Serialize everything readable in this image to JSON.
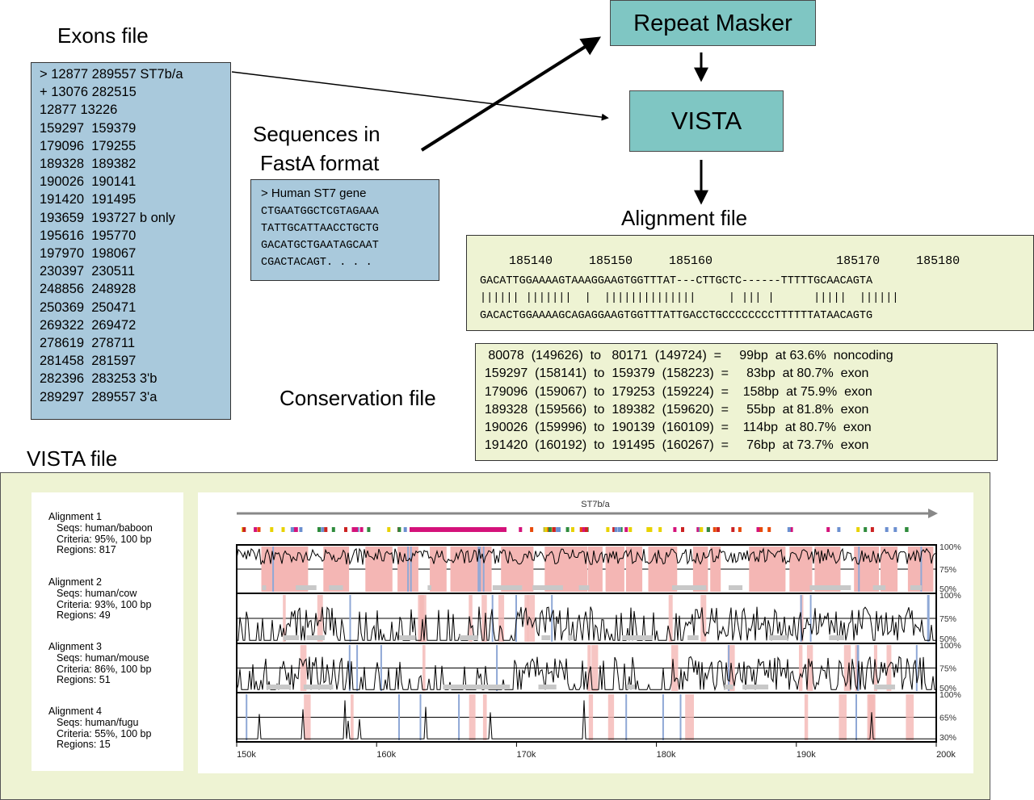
{
  "labels": {
    "exons_title": "Exons file",
    "sequences_title_1": "Sequences in",
    "sequences_title_2": "FastA format",
    "repeat_masker": "Repeat Masker",
    "vista": "VISTA",
    "alignment_title": "Alignment file",
    "conservation_title": "Conservation file",
    "vista_file_title": "VISTA file"
  },
  "exons_file": [
    "> 12877 289557 ST7b/a",
    "+ 13076 282515",
    "12877 13226",
    "159297  159379",
    "179096  179255",
    "189328  189382",
    "190026  190141",
    "191420  191495",
    "193659  193727 b only",
    "195616  195770",
    "197970  198067",
    "230397  230511",
    "248856  248928",
    "250369  250471",
    "269322  269472",
    "278619  278711",
    "281458  281597",
    "282396  283253 3'b",
    "289297  289557 3'a"
  ],
  "fasta": {
    "header": "> Human ST7 gene",
    "lines": [
      "CTGAATGGCTCGTAGAAA",
      "TATTGCATTAACCTGCTG",
      "GACATGCTGAATAGCAAT",
      "CGACTACAGT. . . ."
    ]
  },
  "alignment": {
    "positions": "    185140     185150     185160                 185170     185180",
    "seq1": "GACATTGGAAAAGTAAAGGAAGTGGTTTAT---CTTGCTC------TTTTTGCAACAGTA",
    "match": "|||||| |||||||  |  ||||||||||||||     | ||| |      |||||  ||||||",
    "seq2": "GACACTGGAAAAGCAGAGGAAGTGGTTTATTGACCTGCCCCCCCCTTTTTTATAACAGTG"
  },
  "conservation": [
    "   80078  (149626)  to   80171  (149724)  =     99bp  at 63.6%  noncoding",
    "  159297  (158141)  to  159379  (158223)  =     83bp  at 80.7%  exon",
    "  179096  (159067)  to  179253  (159224)  =    158bp  at 75.9%  exon",
    "  189328  (159566)  to  189382  (159620)  =     55bp  at 81.8%  exon",
    "  190026  (159996)  to  190139  (160109)  =    114bp  at 80.7%  exon",
    "  191420  (160192)  to  191495  (160267)  =     76bp  at 73.7%  exon"
  ],
  "vista_plot": {
    "gene_label": "ST7b/a",
    "alignments": [
      {
        "title": "Alignment 1",
        "seqs": "Seqs: human/baboon",
        "criteria": "Criteria: 95%, 100 bp",
        "regions": "Regions: 817",
        "ticks": [
          "100%",
          "75%",
          "50%"
        ]
      },
      {
        "title": "Alignment 2",
        "seqs": "Seqs: human/cow",
        "criteria": "Criteria: 93%, 100 bp",
        "regions": "Regions: 49",
        "ticks": [
          "100%",
          "75%",
          "50%"
        ]
      },
      {
        "title": "Alignment 3",
        "seqs": "Seqs: human/mouse",
        "criteria": "Criteria: 86%, 100 bp",
        "regions": "Regions: 51",
        "ticks": [
          "100%",
          "75%",
          "50%"
        ]
      },
      {
        "title": "Alignment 4",
        "seqs": "Seqs: human/fugu",
        "criteria": "Criteria: 55%, 100 bp",
        "regions": "Regions: 15",
        "ticks": [
          "100%",
          "65%",
          "30%"
        ]
      }
    ],
    "x_ticks": [
      "150k",
      "160k",
      "170k",
      "180k",
      "190k",
      "200k"
    ],
    "colors": {
      "conserved_fill": "#f4b6b4",
      "exon": "#8fa8d6",
      "gray_bar": "#c8c8c8",
      "panel_bg": "#eef3d3"
    }
  }
}
